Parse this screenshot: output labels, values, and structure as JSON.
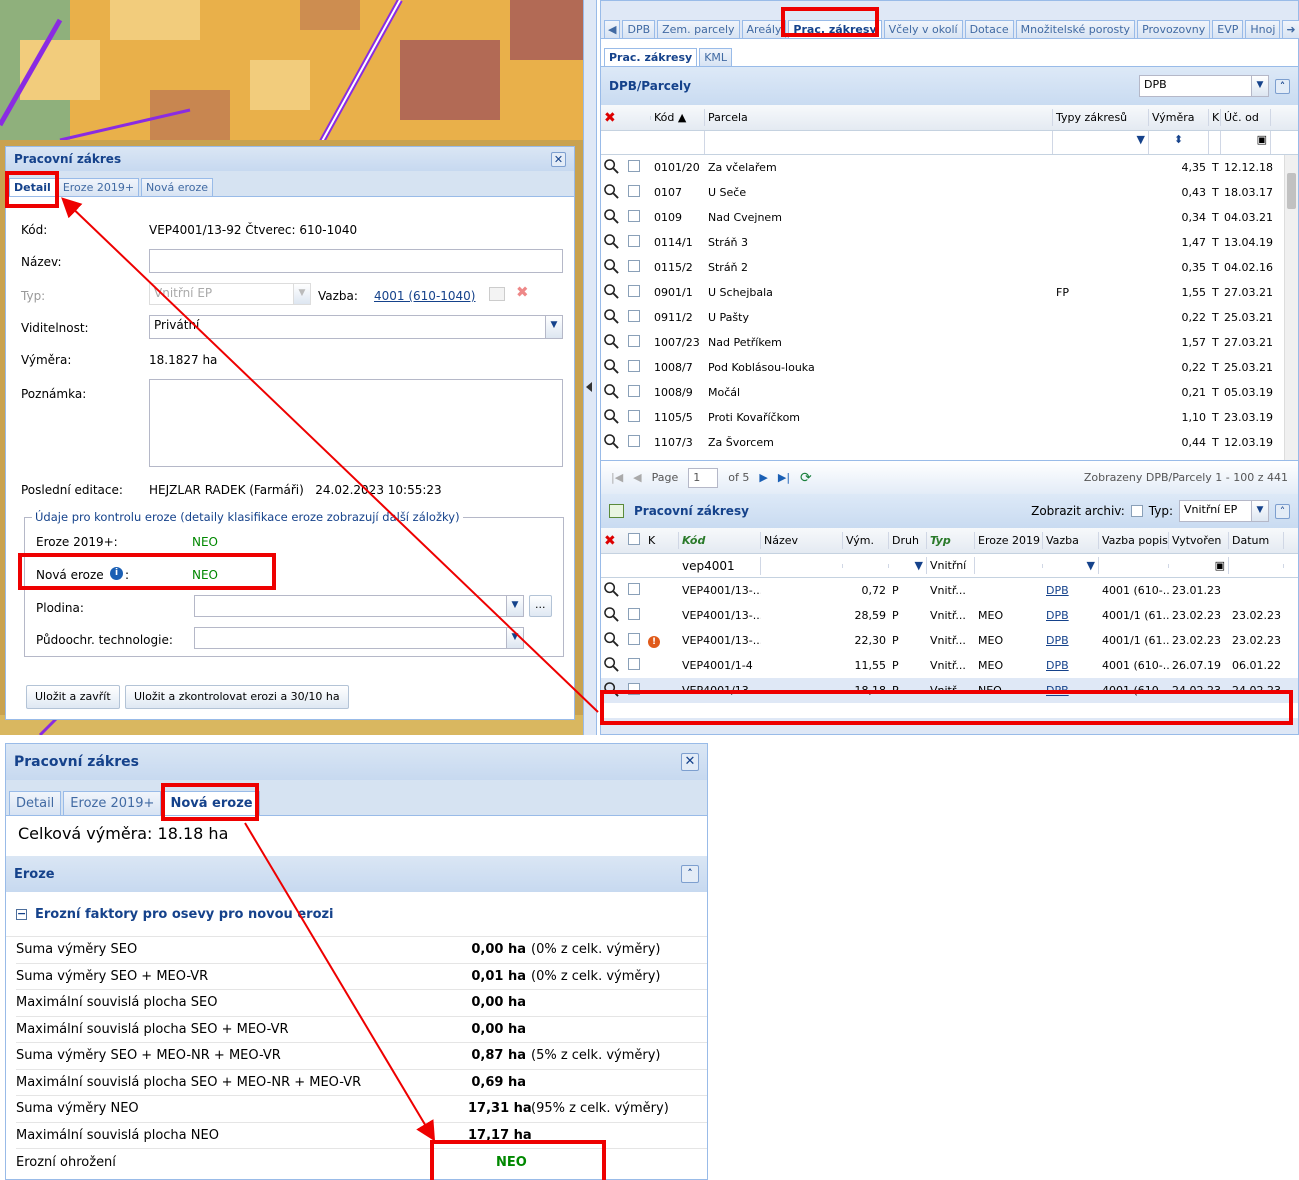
{
  "map": {
    "colors": {
      "base": "#e9b04a",
      "dark": "#b26a55",
      "light": "#f2cc7c",
      "green": "#8fb07c",
      "road": "#8a2be2"
    }
  },
  "left_panel": {
    "title": "Pracovní zákres",
    "tabs": [
      "Detail",
      "Eroze 2019+",
      "Nová eroze"
    ],
    "fields": {
      "kod_label": "Kód:",
      "kod_value": "VEP4001/13-92 Čtverec: 610-1040",
      "nazev_label": "Název:",
      "nazev_value": "",
      "typ_label": "Typ:",
      "typ_value": "Vnitřní EP",
      "vazba_label": "Vazba:",
      "vazba_value": "4001 (610-1040)",
      "viditelnost_label": "Viditelnost:",
      "viditelnost_value": "Privátní",
      "vymera_label": "Výměra:",
      "vymera_value": "18.1827 ha",
      "poznamka_label": "Poznámka:",
      "posledni_label": "Poslední editace:",
      "posledni_value": "HEJZLAR RADEK (Farmáři)   24.02.2023 10:55:23"
    },
    "eroze_section": {
      "legend": "Údaje pro kontrolu eroze (detaily klasifikace eroze zobrazují další záložky)",
      "eroze2019_label": "Eroze 2019+:",
      "eroze2019_value": "NEO",
      "nova_label": "Nová eroze",
      "nova_value": "NEO",
      "plodina_label": "Plodina:",
      "plodina_btn": "...",
      "puda_label": "Půdoochr. technologie:"
    },
    "buttons": {
      "save_close": "Uložit a zavřít",
      "save_check": "Uložit a zkontrolovat erozi a 30/10 ha"
    }
  },
  "right_panel": {
    "top_tabs": [
      "DPB",
      "Zem. parcely",
      "Areály",
      "Prac. zákresy",
      "Včely v okolí",
      "Dotace",
      "Množitelské porosty",
      "Provozovny",
      "EVP",
      "Hnoj"
    ],
    "sub_tabs": [
      "Prac. zákresy",
      "KML"
    ],
    "dpb_title": "DPB/Parcely",
    "dpb_select": "DPB",
    "dpb_headers": {
      "kod": "Kód ▲",
      "parcela": "Parcela",
      "typy": "Typy zákresů",
      "vymera": "Výměra",
      "k": "K",
      "uc": "Úč. od"
    },
    "dpb_rows": [
      {
        "kod": "0101/20",
        "parcela": "Za včelařem",
        "typy": "",
        "vymera": "4,35",
        "k": "T",
        "uc": "12.12.18"
      },
      {
        "kod": "0107",
        "parcela": "U Seče",
        "typy": "",
        "vymera": "0,43",
        "k": "T",
        "uc": "18.03.17"
      },
      {
        "kod": "0109",
        "parcela": "Nad Cvejnem",
        "typy": "",
        "vymera": "0,34",
        "k": "T",
        "uc": "04.03.21"
      },
      {
        "kod": "0114/1",
        "parcela": "Stráň 3",
        "typy": "",
        "vymera": "1,47",
        "k": "T",
        "uc": "13.04.19"
      },
      {
        "kod": "0115/2",
        "parcela": "Stráň 2",
        "typy": "",
        "vymera": "0,35",
        "k": "T",
        "uc": "04.02.16"
      },
      {
        "kod": "0901/1",
        "parcela": "U Schejbala",
        "typy": "FP",
        "vymera": "1,55",
        "k": "T",
        "uc": "27.03.21"
      },
      {
        "kod": "0911/2",
        "parcela": "U Pašty",
        "typy": "",
        "vymera": "0,22",
        "k": "T",
        "uc": "25.03.21"
      },
      {
        "kod": "1007/23",
        "parcela": "Nad Petříkem",
        "typy": "",
        "vymera": "1,57",
        "k": "T",
        "uc": "27.03.21"
      },
      {
        "kod": "1008/7",
        "parcela": "Pod Koblásou-louka",
        "typy": "",
        "vymera": "0,22",
        "k": "T",
        "uc": "25.03.21"
      },
      {
        "kod": "1008/9",
        "parcela": "Močál",
        "typy": "",
        "vymera": "0,21",
        "k": "T",
        "uc": "05.03.19"
      },
      {
        "kod": "1105/5",
        "parcela": "Proti Kovaříčkom",
        "typy": "",
        "vymera": "1,10",
        "k": "T",
        "uc": "23.03.19"
      },
      {
        "kod": "1107/3",
        "parcela": "Za Švorcem",
        "typy": "",
        "vymera": "0,44",
        "k": "T",
        "uc": "12.03.19"
      }
    ],
    "pager": {
      "page_label": "Page",
      "page_value": "1",
      "of": "of 5",
      "info": "Zobrazeny DPB/Parcely 1 - 100 z 441"
    },
    "pz_title": "Pracovní zákresy",
    "pz_archiv": "Zobrazit archiv:",
    "pz_typ_label": "Typ:",
    "pz_typ_value": "Vnitřní EP",
    "pz_headers": {
      "k": "K",
      "kod": "Kód",
      "nazev": "Název",
      "vym": "Vým.",
      "druh": "Druh",
      "typ": "Typ",
      "eroze": "Eroze 2019",
      "vazba": "Vazba",
      "vazba_popis": "Vazba popis",
      "vytvoren": "Vytvořen",
      "datum": "Datum"
    },
    "pz_filter_kod": "vep4001",
    "pz_filter_typ": "Vnitřní",
    "pz_rows": [
      {
        "kod": "VEP4001/13-...",
        "vym": "0,72",
        "druh": "P",
        "typ": "Vnitř...",
        "eroze": "",
        "vazba": "DPB",
        "popis": "4001 (610-...",
        "vytvoren": "23.01.23",
        "datum": "",
        "warn": false
      },
      {
        "kod": "VEP4001/13-...",
        "vym": "28,59",
        "druh": "P",
        "typ": "Vnitř...",
        "eroze": "MEO",
        "vazba": "DPB",
        "popis": "4001/1 (61...",
        "vytvoren": "23.02.23",
        "datum": "23.02.23",
        "warn": false
      },
      {
        "kod": "VEP4001/13-...",
        "vym": "22,30",
        "druh": "P",
        "typ": "Vnitř...",
        "eroze": "MEO",
        "vazba": "DPB",
        "popis": "4001/1 (61...",
        "vytvoren": "23.02.23",
        "datum": "23.02.23",
        "warn": true
      },
      {
        "kod": "VEP4001/1-4",
        "vym": "11,55",
        "druh": "P",
        "typ": "Vnitř...",
        "eroze": "MEO",
        "vazba": "DPB",
        "popis": "4001 (610-...",
        "vytvoren": "26.07.19",
        "datum": "06.01.22",
        "warn": false
      },
      {
        "kod": "VEP4001/13-...",
        "vym": "18,18",
        "druh": "P",
        "typ": "Vnitř...",
        "eroze": "NEO",
        "vazba": "DPB",
        "popis": "4001 (610-...",
        "vytvoren": "24.02.23",
        "datum": "24.02.23",
        "warn": false
      }
    ]
  },
  "bottom_panel": {
    "title": "Pracovní zákres",
    "tabs": [
      "Detail",
      "Eroze 2019+",
      "Nová eroze"
    ],
    "celkova": "Celková výměra: 18.18 ha",
    "eroze_title": "Eroze",
    "group_title": "Erozní faktory pro osevy pro novou erozi",
    "rows": [
      {
        "label": "Suma výměry SEO",
        "value": "0,00 ha",
        "note": "(0% z celk. výměry)"
      },
      {
        "label": "Suma výměry SEO + MEO-VR",
        "value": "0,01 ha",
        "note": "(0% z celk. výměry)"
      },
      {
        "label": "Maximální souvislá plocha SEO",
        "value": "0,00 ha",
        "note": ""
      },
      {
        "label": "Maximální souvislá plocha SEO + MEO-VR",
        "value": "0,00 ha",
        "note": ""
      },
      {
        "label": "Suma výměry SEO + MEO-NR + MEO-VR",
        "value": "0,87 ha",
        "note": "(5% z celk. výměry)"
      },
      {
        "label": "Maximální souvislá plocha SEO + MEO-NR + MEO-VR",
        "value": "0,69 ha",
        "note": ""
      },
      {
        "label": "Suma výměry NEO",
        "value": "17,31 ha",
        "note": "(95% z celk. výměry)"
      },
      {
        "label": "Maximální souvislá plocha NEO",
        "value": "17,17 ha",
        "note": ""
      }
    ],
    "ohrozeni_label": "Erozní ohrožení",
    "ohrozeni_value": "NEO"
  }
}
